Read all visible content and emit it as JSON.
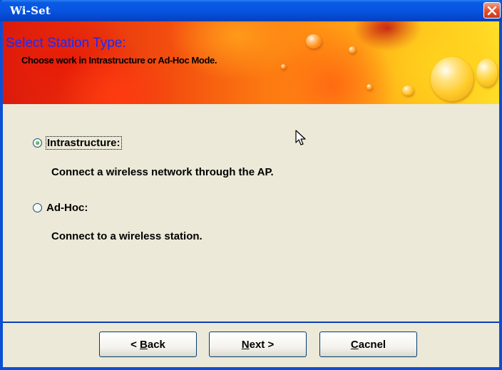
{
  "window": {
    "title": "Wi-Set",
    "close_icon": "close-icon"
  },
  "banner": {
    "title": "Select Station Type:",
    "subtitle": "Choose work in Intrastructure or Ad-Hoc Mode."
  },
  "options": [
    {
      "label": "Intrastructure:",
      "description": "Connect a wireless network through the AP.",
      "selected": true
    },
    {
      "label": "Ad-Hoc:",
      "description": "Connect to a wireless station.",
      "selected": false
    }
  ],
  "buttons": {
    "back": {
      "prefix": "< ",
      "accel": "B",
      "rest": "ack"
    },
    "next": {
      "accel": "N",
      "rest": "ext >"
    },
    "cancel": {
      "accel": "C",
      "rest": "acnel"
    }
  },
  "colors": {
    "titlebar": "#0755e0",
    "banner_title": "#1a2bff",
    "close_button": "#e2512f",
    "radio_checked": "#2ea02e"
  }
}
